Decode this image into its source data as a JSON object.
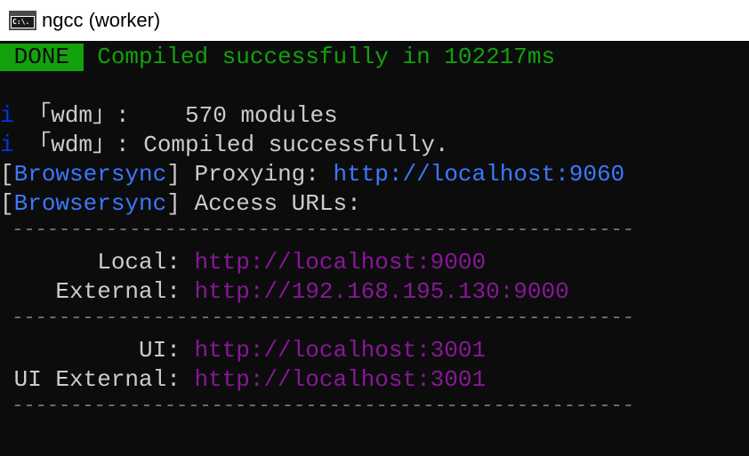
{
  "window": {
    "title": "ngcc (worker)",
    "icon": "command-prompt-icon",
    "icon_glyph": "C:\\."
  },
  "colors": {
    "background": "#0c0c0c",
    "text": "#cccccc",
    "success_green": "#13a10e",
    "info_blue": "#0037da",
    "link_blue": "#3b78ff",
    "link_purple": "#881798",
    "rule_gray": "#767676"
  },
  "terminal": {
    "status": {
      "badge": " DONE ",
      "message": " Compiled successfully in 102217ms"
    },
    "wdm_modules": {
      "icon": "i",
      "tag": " 「wdm」:",
      "text": "    570 modules"
    },
    "wdm_compiled": {
      "icon": "i",
      "tag": " 「wdm」:",
      "text": " Compiled successfully."
    },
    "browsersync_proxy": {
      "open": "[",
      "name": "Browsersync",
      "close": "]",
      "label": " Proxying: ",
      "url": "http://localhost:9060"
    },
    "browsersync_access": {
      "open": "[",
      "name": "Browsersync",
      "close": "]",
      "label": " Access URLs:"
    },
    "rule": " -----------------------------------------------------",
    "local": {
      "label": "       Local: ",
      "url": "http://localhost:9000"
    },
    "external": {
      "label": "    External: ",
      "url": "http://192.168.195.130:9000"
    },
    "ui": {
      "label": "          UI: ",
      "url": "http://localhost:3001"
    },
    "ui_external": {
      "label": " UI External: ",
      "url": "http://localhost:3001"
    }
  }
}
